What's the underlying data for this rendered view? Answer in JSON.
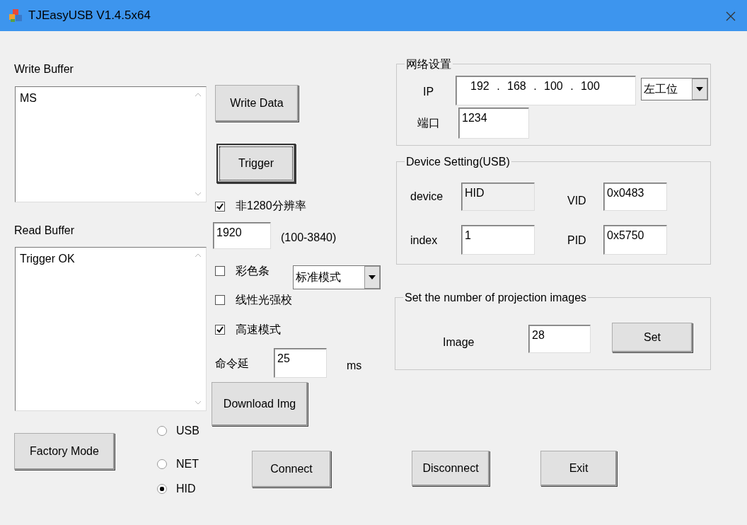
{
  "window": {
    "title": "TJEasyUSB V1.4.5x64"
  },
  "write_buffer": {
    "label": "Write Buffer",
    "value": "MS"
  },
  "write_data_button": {
    "label": "Write Data"
  },
  "trigger_button": {
    "label": "Trigger",
    "focused": true
  },
  "read_buffer": {
    "label": "Read Buffer",
    "value": "Trigger OK"
  },
  "resolution": {
    "label": "非1280分辨率",
    "checked": true,
    "value": "1920",
    "range": "(100-3840)"
  },
  "color_stripes": {
    "label": "彩色条",
    "checked": false,
    "mode": "标准模式"
  },
  "linear_correction": {
    "label": "线性光强校",
    "checked": false
  },
  "high_speed": {
    "label": "高速模式",
    "checked": true
  },
  "command_delay": {
    "label": "命令延",
    "value": "25",
    "unit": "ms"
  },
  "download_button": {
    "label": "Download Img"
  },
  "factory_button": {
    "label": "Factory Mode"
  },
  "connection": [
    {
      "label": "USB",
      "selected": false
    },
    {
      "label": "NET",
      "selected": false
    },
    {
      "label": "HID",
      "selected": true
    }
  ],
  "connect_button": {
    "label": "Connect"
  },
  "disconnect_button": {
    "label": "Disconnect"
  },
  "exit_button": {
    "label": "Exit"
  },
  "network": {
    "title": "网络设置",
    "ip_label": "IP",
    "ip": "192 . 168 . 100 . 100",
    "station": "左工位",
    "port_label": "端口",
    "port": "1234"
  },
  "device": {
    "title": "Device Setting(USB)",
    "device_label": "device",
    "device": "HID",
    "device_disabled": true,
    "vid_label": "VID",
    "vid": "0x0483",
    "index_label": "index",
    "index": "1",
    "pid_label": "PID",
    "pid": "0x5750"
  },
  "projection": {
    "title": "Set the number of projection images",
    "image_label": "Image",
    "image": "28",
    "set_button": "Set"
  }
}
